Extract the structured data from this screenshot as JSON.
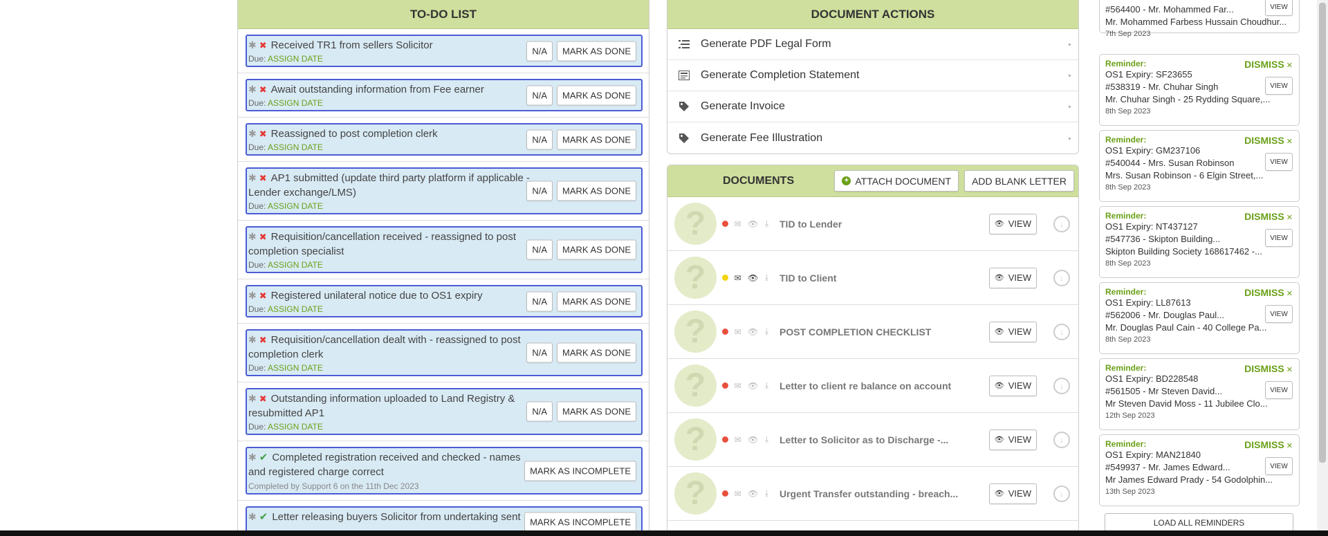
{
  "todo": {
    "title": "TO-DO LIST",
    "due_prefix": "Due:",
    "assign_date": "ASSIGN DATE",
    "na_label": "N/A",
    "mark_done_label": "MARK AS DONE",
    "mark_incomplete_label": "MARK AS INCOMPLETE",
    "items": [
      {
        "title": "Received TR1 from sellers Solicitor"
      },
      {
        "title": "Await outstanding information from Fee earner"
      },
      {
        "title": "Reassigned to post completion clerk"
      },
      {
        "title": "AP1 submitted (update third party platform if applicable - Lender exchange/LMS)"
      },
      {
        "title": "Requisition/cancellation received - reassigned to post completion specialist"
      },
      {
        "title": "Registered unilateral notice due to OS1 expiry"
      },
      {
        "title": "Requisition/cancellation dealt with - reassigned to post completion clerk"
      },
      {
        "title": "Outstanding information uploaded to Land Registry & resubmitted AP1"
      }
    ],
    "done_items": [
      {
        "title": "Completed registration received and checked - names and registered charge correct",
        "completed": "Completed by Support 6 on the 11th Dec 2023"
      },
      {
        "title": "Letter releasing buyers Solicitor from undertaking sent",
        "completed": ""
      }
    ]
  },
  "document_actions": {
    "title": "DOCUMENT ACTIONS",
    "items": [
      {
        "label": "Generate PDF Legal Form",
        "icon": "list-icon"
      },
      {
        "label": "Generate Completion Statement",
        "icon": "statement-icon"
      },
      {
        "label": "Generate Invoice",
        "icon": "tag-icon"
      },
      {
        "label": "Generate Fee Illustration",
        "icon": "tag-icon"
      }
    ]
  },
  "documents": {
    "title": "DOCUMENTS",
    "attach_label": "ATTACH DOCUMENT",
    "blank_letter_label": "ADD BLANK LETTER",
    "view_label": "VIEW",
    "thumb_glyph": "?",
    "items": [
      {
        "name": "TID to Lender",
        "status_color": "#e8503c"
      },
      {
        "name": "TID to Client",
        "status_color": "#f5d20c"
      },
      {
        "name": "POST COMPLETION CHECKLIST",
        "status_color": "#e8503c"
      },
      {
        "name": "Letter to client re balance on account",
        "status_color": "#e8503c"
      },
      {
        "name": "Letter to Solicitor as to Discharge -...",
        "status_color": "#e8503c"
      },
      {
        "name": "Urgent Transfer outstanding - breach...",
        "status_color": "#e8503c"
      }
    ]
  },
  "reminders": {
    "label": "Reminder:",
    "dismiss_label": "DISMISS",
    "view_label": "VIEW",
    "load_all_label": "LOAD ALL REMINDERS",
    "partial": {
      "line1": "#564400 - Mr. Mohammed Far...",
      "line2": "Mr. Mohammed Farbess Hussain Choudhur...",
      "date": "7th Sep 2023"
    },
    "items": [
      {
        "line0": "OS1 Expiry: SF23655",
        "line1": "#538319 - Mr. Chuhar Singh",
        "line2": "Mr. Chuhar Singh - 25 Rydding Square,...",
        "date": "8th Sep 2023"
      },
      {
        "line0": "OS1 Expiry: GM237106",
        "line1": "#540044 - Mrs. Susan Robinson",
        "line2": "Mrs. Susan Robinson - 6 Elgin Street,...",
        "date": "8th Sep 2023"
      },
      {
        "line0": "OS1 Expiry: NT437127",
        "line1": "#547736 - Skipton Building...",
        "line2": "Skipton Building Society 168617462 -...",
        "date": "8th Sep 2023"
      },
      {
        "line0": "OS1 Expiry: LL87613",
        "line1": "#562006 - Mr. Douglas Paul...",
        "line2": "Mr. Douglas Paul Cain - 40 College Pa...",
        "date": "8th Sep 2023"
      },
      {
        "line0": "OS1 Expiry: BD228548",
        "line1": "#561505 - Mr Steven David...",
        "line2": "Mr Steven David Moss - 11 Jubilee Clo...",
        "date": "12th Sep 2023"
      },
      {
        "line0": "OS1 Expiry: MAN21840",
        "line1": "#549937 - Mr. James Edward...",
        "line2": "Mr James Edward Prady - 54 Godolphin...",
        "date": "13th Sep 2023"
      }
    ]
  }
}
